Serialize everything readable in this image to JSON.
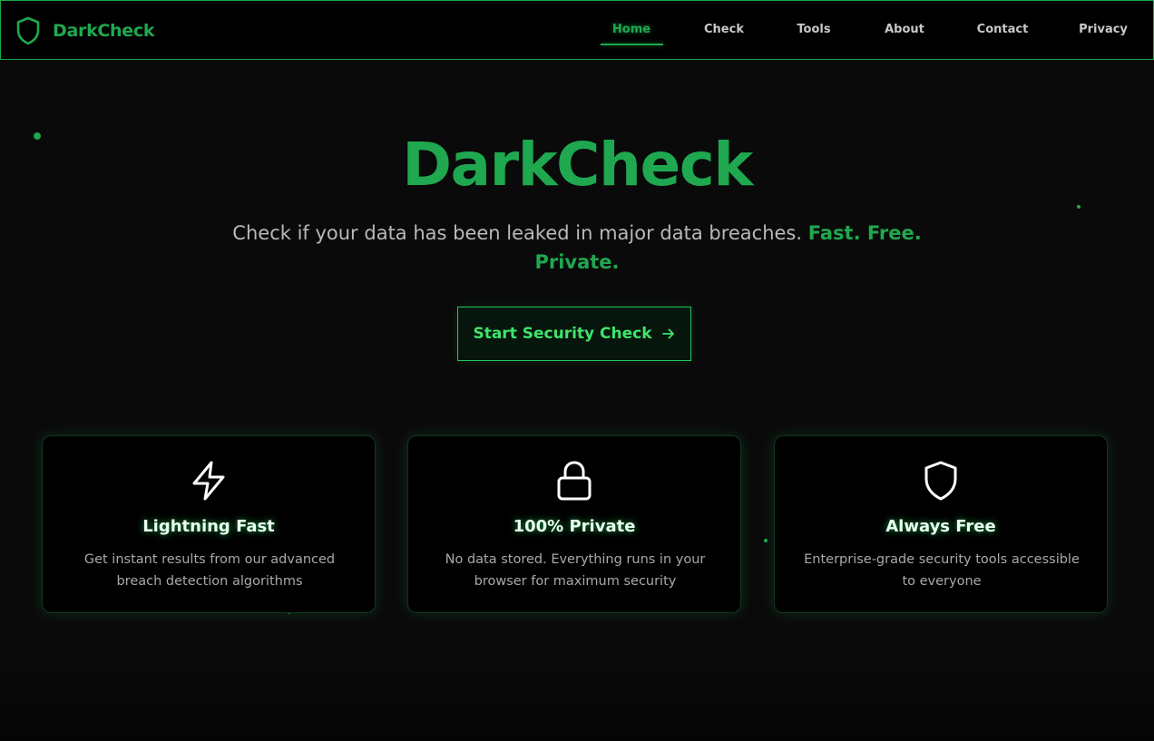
{
  "nav": {
    "brand": "DarkCheck",
    "links": [
      {
        "label": "Home",
        "active": true
      },
      {
        "label": "Check"
      },
      {
        "label": "Tools"
      },
      {
        "label": "About"
      },
      {
        "label": "Contact"
      },
      {
        "label": "Privacy"
      }
    ]
  },
  "hero": {
    "title": "DarkCheck",
    "subtitle": "Check if your data has been leaked in major data breaches.",
    "subtitle_accent": "Fast. Free. Private.",
    "cta_label": "Start Security Check"
  },
  "features": [
    {
      "icon": "lightning-icon",
      "title": "Lightning Fast",
      "desc": "Get instant results from our advanced breach detection algorithms"
    },
    {
      "icon": "lock-icon",
      "title": "100% Private",
      "desc": "No data stored. Everything runs in your browser for maximum security"
    },
    {
      "icon": "shield-icon",
      "title": "Always Free",
      "desc": "Enterprise-grade security tools accessible to everyone"
    }
  ],
  "colors": {
    "accent": "#1fa84f",
    "accent_bright": "#22c55e",
    "background": "#0a0a0a",
    "card_background": "#000000"
  }
}
